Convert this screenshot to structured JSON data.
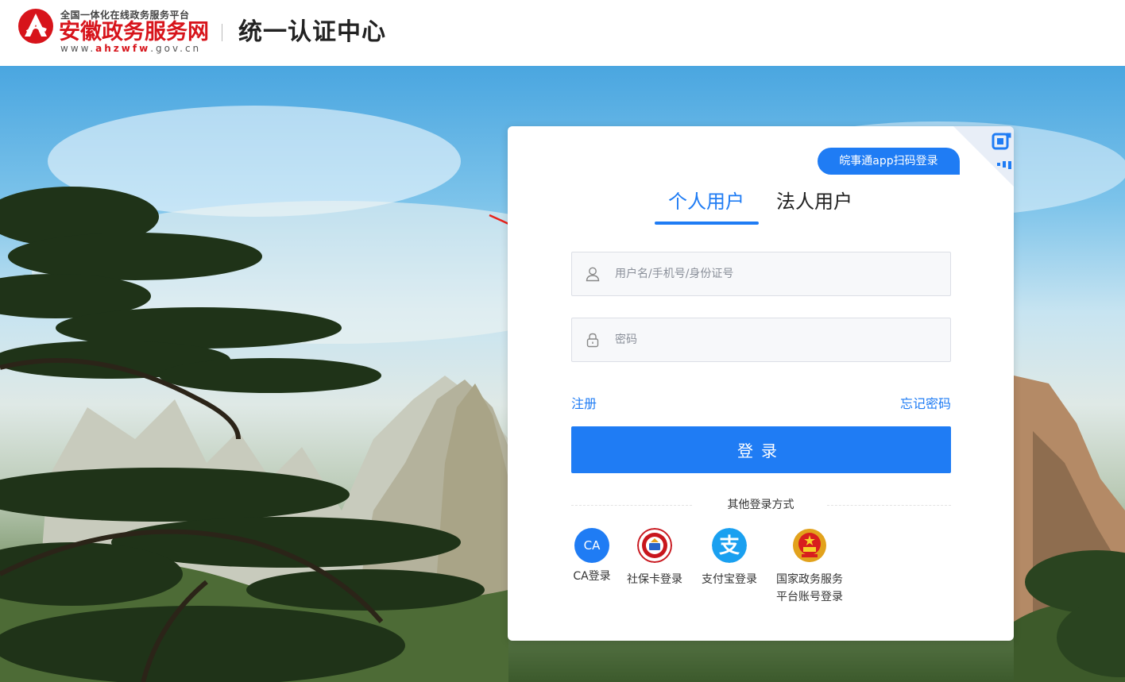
{
  "header": {
    "logo_small_text": "全国一体化在线政务服务平台",
    "logo_big_text": "安徽政务服务网",
    "logo_url_pre": "www.",
    "logo_url_mid": "ahzwfw",
    "logo_url_post": ".gov.cn",
    "title": "统一认证中心"
  },
  "login": {
    "qr_label": "皖事通app扫码登录",
    "tabs": [
      {
        "label": "个人用户",
        "active": true
      },
      {
        "label": "法人用户",
        "active": false
      }
    ],
    "username_placeholder": "用户名/手机号/身份证号",
    "password_placeholder": "密码",
    "register_label": "注册",
    "forgot_label": "忘记密码",
    "submit_label": "登录",
    "other_title": "其他登录方式",
    "other_methods": [
      {
        "label": "CA登录",
        "icon": "ca-icon",
        "icon_text": "CA"
      },
      {
        "label": "社保卡登录",
        "icon": "social-security-card-icon"
      },
      {
        "label": "支付宝登录",
        "icon": "alipay-icon"
      },
      {
        "label_line1": "国家政务服务",
        "label_line2": "平台账号登录",
        "icon": "national-emblem-icon"
      }
    ]
  },
  "colors": {
    "accent": "#1f7cf4",
    "brand_red": "#d7141b",
    "annotation_arrow": "#e8241c"
  }
}
